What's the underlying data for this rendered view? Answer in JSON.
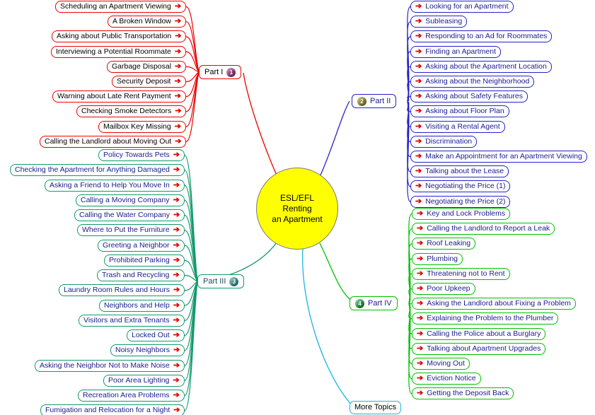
{
  "central": {
    "line1": "ESL/EFL",
    "line2": "Renting",
    "line3": "an Apartment",
    "fill": "#ffff00",
    "border": "#7a7a7a"
  },
  "arrow_glyph": "➔",
  "branches": {
    "part1": {
      "label": "Part I",
      "badge": "1",
      "badge_color": "#8e3f75",
      "color": "#ee0000",
      "text_color": "#000000",
      "side": "left",
      "items": [
        "Scheduling an Apartment Viewing",
        "A Broken Window",
        "Asking about Public Transportation",
        "Interviewing a Potential Roommate",
        "Garbage Disposal",
        "Security Deposit",
        "Warning about Late Rent Payment",
        "Checking Smoke Detectors",
        "Mailbox Key Missing",
        "Calling the Landlord about Moving Out"
      ]
    },
    "part2": {
      "label": "Part II",
      "badge": "2",
      "badge_color": "#8d8434",
      "color": "#2222cc",
      "text_color": "#1b1b8f",
      "side": "right",
      "items": [
        "Looking for an Apartment",
        "Subleasing",
        "Responding to an Ad for Roommates",
        "Finding an Apartment",
        "Asking about the Apartment Location",
        "Asking about the Neighborhood",
        "Asking about Safety Features",
        "Asking about Floor Plan",
        "Visiting a Rental Agent",
        "Discrimination",
        "Make an Appointment for an Apartment Viewing",
        "Talking about the Lease",
        "Negotiating the Price (1)",
        "Negotiating the Price (2)"
      ]
    },
    "part3": {
      "label": "Part III",
      "badge": "3",
      "badge_color": "#3f8e8e",
      "color": "#13996b",
      "text_color": "#1b1b8f",
      "side": "left",
      "items": [
        "Policy Towards Pets",
        "Checking the Apartment for Anything Damaged",
        "Asking a Friend to Help You Move In",
        "Calling a Moving Company",
        "Calling the Water Company",
        "Where to Put the Furniture",
        "Greeting a Neighbor",
        "Prohibited Parking",
        "Trash and Recycling",
        "Laundry Room Rules and Hours",
        "Neighbors and Help",
        "Visitors and Extra Tenants",
        "Locked Out",
        "Noisy Neighbors",
        "Asking the Neighbor Not to Make Noise",
        "Poor Area Lighting",
        "Recreation Area Problems",
        "Fumigation and Relocation for a Night"
      ]
    },
    "part4": {
      "label": "Part IV",
      "badge": "4",
      "badge_color": "#1f9c3f",
      "color": "#00c000",
      "text_color": "#1b1b8f",
      "side": "right",
      "items": [
        "Key and Lock Problems",
        "Calling the Landlord to Report a Leak",
        "Roof Leaking",
        "Plumbing",
        "Threatening not to Rent",
        "Poor Upkeep",
        "Asking the Landlord about Fixing a Problem",
        "Explaining the Problem to the Plumber",
        "Calling the Police about a Burglary",
        "Talking about Apartment Upgrades",
        "Moving Out",
        "Eviction Notice",
        "Getting the Deposit Back"
      ]
    },
    "more": {
      "label": "More Topics",
      "color": "#1bb5e0",
      "text_color": "#000000"
    }
  }
}
